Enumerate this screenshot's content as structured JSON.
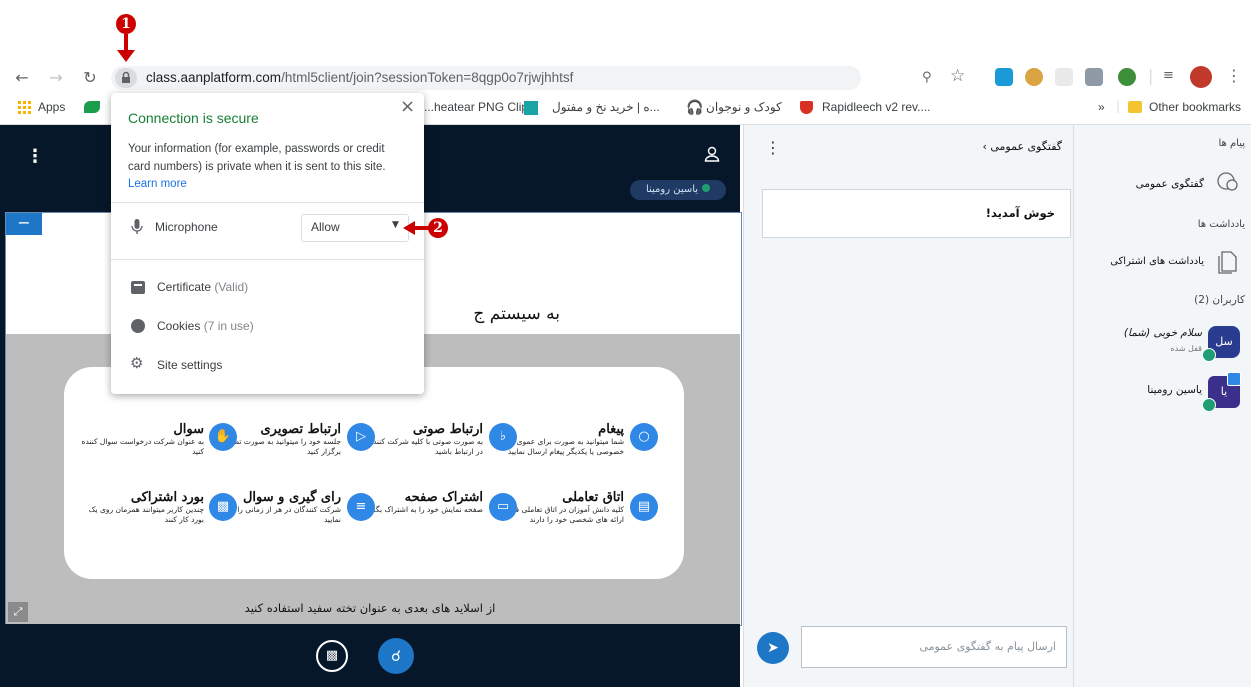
{
  "browser": {
    "url_host": "class.aanplatform.com",
    "url_path": "/html5client/join?sessionToken=8qgp0o7rjwjhhtsf",
    "bookmarks": {
      "apps": "Apps",
      "item1": "...heatear PNG Clip",
      "item2": "...ه | خرید نخ و مفتول",
      "item3": "کودک و نوجوان",
      "item4": "Rapidleech v2 rev....",
      "more": "»",
      "other": "Other bookmarks"
    }
  },
  "popup": {
    "title": "Connection is secure",
    "text": "Your information (for example, passwords or credit card numbers) is private when it is sent to this site.",
    "learn_more": "Learn more",
    "microphone_label": "Microphone",
    "microphone_value": "Allow",
    "certificate": "Certificate",
    "certificate_status": "(Valid)",
    "cookies": "Cookies",
    "cookies_status": "(7 in use)",
    "site_settings": "Site settings",
    "close": "×"
  },
  "markers": {
    "one": "1",
    "two": "2"
  },
  "presentation": {
    "user_badge": "یاسین رومینا",
    "welcome_heading": "به سیستم ج",
    "footer_note": "از اسلاید های بعدی به عنوان تخته سفید استفاده کنید",
    "features": [
      {
        "title": "پیغام",
        "desc": "شما میتوانید به صورت برای عموی خصوصی یا یکدیگر پیغام ارسال نمایید"
      },
      {
        "title": "ارتباط صوتی",
        "desc": "به صورت صوتی با کلیه شرکت کنندگان در ارتباط باشید"
      },
      {
        "title": "ارتباط تصویری",
        "desc": "جلسه خود را میتوانید به صورت تصویری برگزار کنید"
      },
      {
        "title": "سوال",
        "desc": "به عنوان شرکت درخواست سوال کننده کنید"
      },
      {
        "title": "اتاق تعاملی",
        "desc": "کلیه دانش آموزان در اتاق تعاملی قابلیت ارائه های شخصی خود را دارند"
      },
      {
        "title": "اشتراک صفحه",
        "desc": "صفحه نمایش خود را به اشتراک بگذارید"
      },
      {
        "title": "رای گیری و سوال",
        "desc": "شرکت کنندگان در هر از زمانی را گیری نمایید"
      },
      {
        "title": "بورد اشتراکی",
        "desc": "چندین کاربر میتوانند همزمان روی یک بورد کار کنند"
      }
    ]
  },
  "chat": {
    "header": "گفتگوی عمومی",
    "welcome": "خوش آمدید!",
    "input_placeholder": "ارسال پیام به گفتگوی عمومی"
  },
  "sidebar": {
    "messages_title": "پیام ها",
    "public_chat": "گفتگوی عمومی",
    "notes_title": "یادداشت ها",
    "shared_notes": "یادداشت های اشتراکی",
    "users_title": "کاربران (2)",
    "users": [
      {
        "initials": "سل",
        "name": "سلام خوبی (شما)",
        "status": "قفل شده"
      },
      {
        "initials": "یا",
        "name": "یاسین رومینا",
        "status": ""
      }
    ]
  }
}
